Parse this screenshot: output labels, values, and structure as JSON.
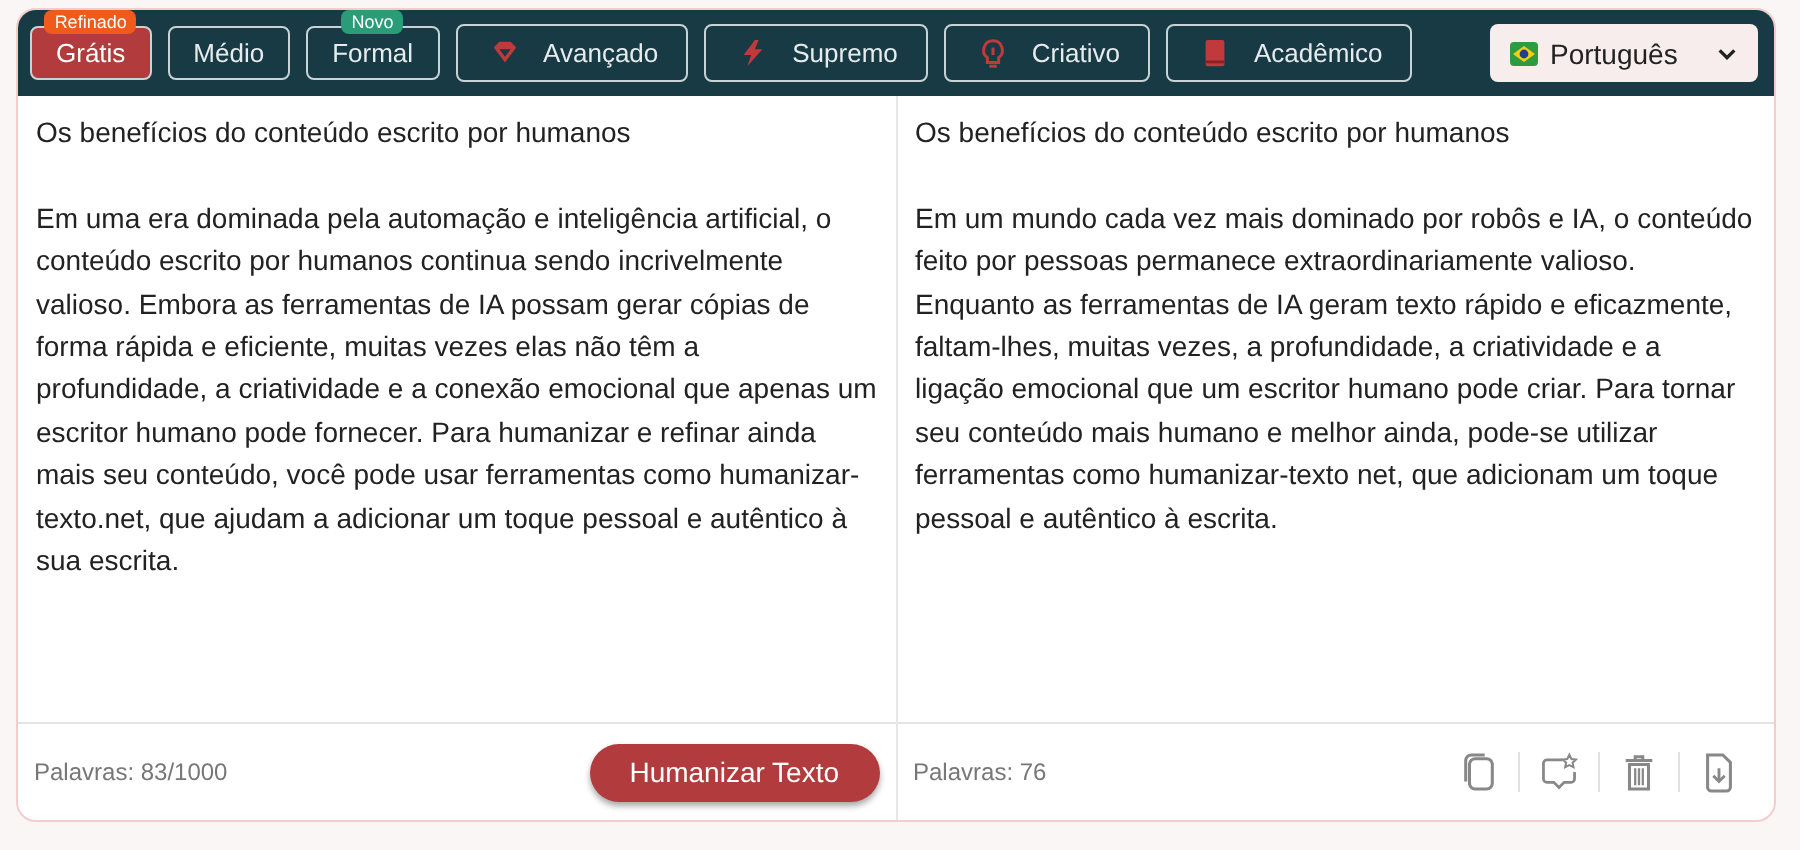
{
  "modes": [
    {
      "label": "Grátis",
      "selected": true,
      "badge": {
        "text": "Refinado",
        "color": "#f05a1a"
      }
    },
    {
      "label": "Médio",
      "selected": false
    },
    {
      "label": "Formal",
      "selected": false,
      "badge": {
        "text": "Novo",
        "color": "#2a9d78"
      }
    },
    {
      "label": "Avançado",
      "selected": false,
      "kind": "gem"
    },
    {
      "label": "Supremo",
      "selected": false,
      "kind": "bolt"
    },
    {
      "label": "Criativo",
      "selected": false,
      "kind": "bulb"
    },
    {
      "label": "Acadêmico",
      "selected": false,
      "kind": "book"
    }
  ],
  "language": {
    "value": "Português"
  },
  "input": {
    "title": "Os benefícios do conteúdo escrito por humanos",
    "body": "Em uma era dominada pela automação e inteligência artificial, o conteúdo escrito por humanos continua sendo incrivelmente valioso. Embora as ferramentas de IA possam gerar cópias de forma rápida e eficiente, muitas vezes elas não têm a profundidade, a criatividade e a conexão emocional que apenas um escritor humano pode fornecer. Para humanizar e refinar ainda mais seu conteúdo, você pode usar ferramentas como humanizar-texto.net, que ajudam a adicionar um toque pessoal e autêntico à sua escrita.",
    "word_count": "Palavras: 83/1000",
    "button": "Humanizar Texto"
  },
  "output": {
    "title": "Os benefícios do conteúdo escrito por humanos",
    "body": "Em um mundo cada vez mais dominado por robôs e IA, o conteúdo feito por pessoas permanece extraordinariamente valioso. Enquanto as ferramentas de IA geram texto rápido e eficazmente, faltam-lhes, muitas vezes, a profundidade, a criatividade e a ligação emocional que um escritor humano pode criar. Para tornar seu conteúdo mais humano e melhor ainda, pode-se utilizar ferramentas como humanizar-texto net, que adicionam um toque pessoal e autêntico à escrita.",
    "word_count": "Palavras: 76",
    "actions": [
      {
        "kind": "copy"
      },
      {
        "kind": "feedback"
      },
      {
        "kind": "delete"
      },
      {
        "kind": "download"
      }
    ]
  }
}
